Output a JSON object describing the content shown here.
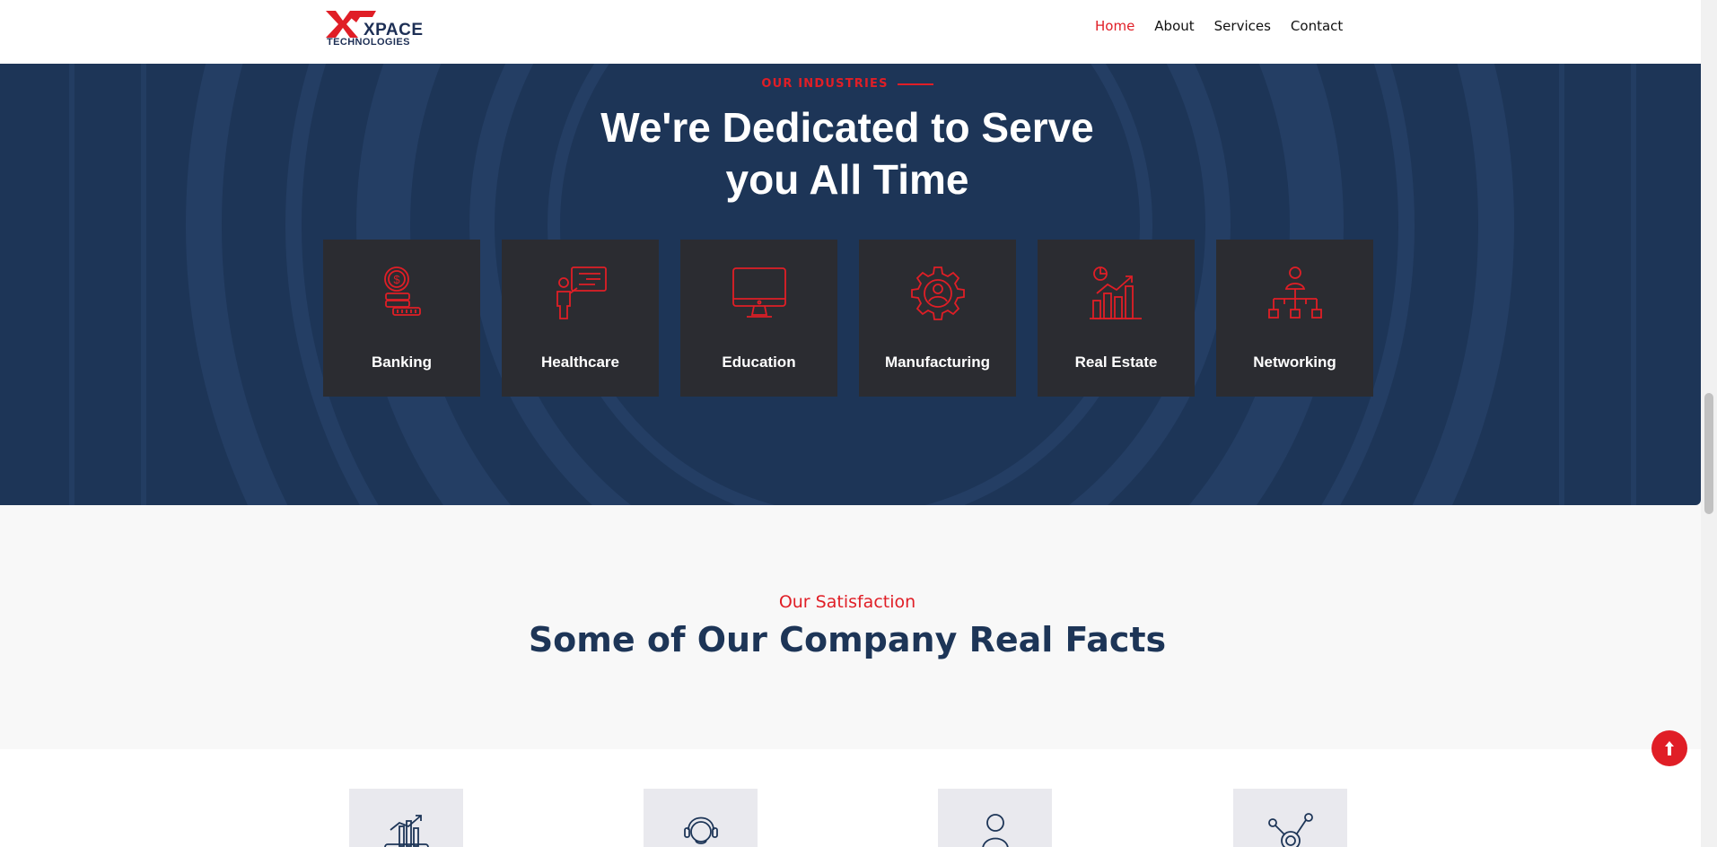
{
  "brand": {
    "logo_word": "XPACE",
    "logo_sub": "TECHNOLOGIES"
  },
  "nav": {
    "items": [
      "Home",
      "About",
      "Services",
      "Contact"
    ],
    "active": "Home"
  },
  "industries": {
    "kicker": "OUR INDUSTRIES",
    "title_line1": "We're Dedicated to Serve",
    "title_line2": "you All Time",
    "cards": [
      {
        "label": "Banking",
        "icon": "coin-stack-icon"
      },
      {
        "label": "Healthcare",
        "icon": "presenter-board-icon"
      },
      {
        "label": "Education",
        "icon": "monitor-icon"
      },
      {
        "label": "Manufacturing",
        "icon": "gear-user-icon"
      },
      {
        "label": "Real Estate",
        "icon": "bar-chart-growth-icon"
      },
      {
        "label": "Networking",
        "icon": "org-chart-icon"
      }
    ]
  },
  "facts": {
    "kicker": "Our Satisfaction",
    "title": "Some of Our Company Real Facts",
    "boxes": [
      {
        "icon": "growth-chart-icon"
      },
      {
        "icon": "support-agent-icon"
      },
      {
        "icon": "user-icon"
      },
      {
        "icon": "network-nodes-icon"
      }
    ]
  },
  "scroll_top": {
    "icon": "arrow-up-icon"
  },
  "colors": {
    "accent": "#e01e26",
    "navy": "#1d3557",
    "card": "#2b2c31"
  }
}
